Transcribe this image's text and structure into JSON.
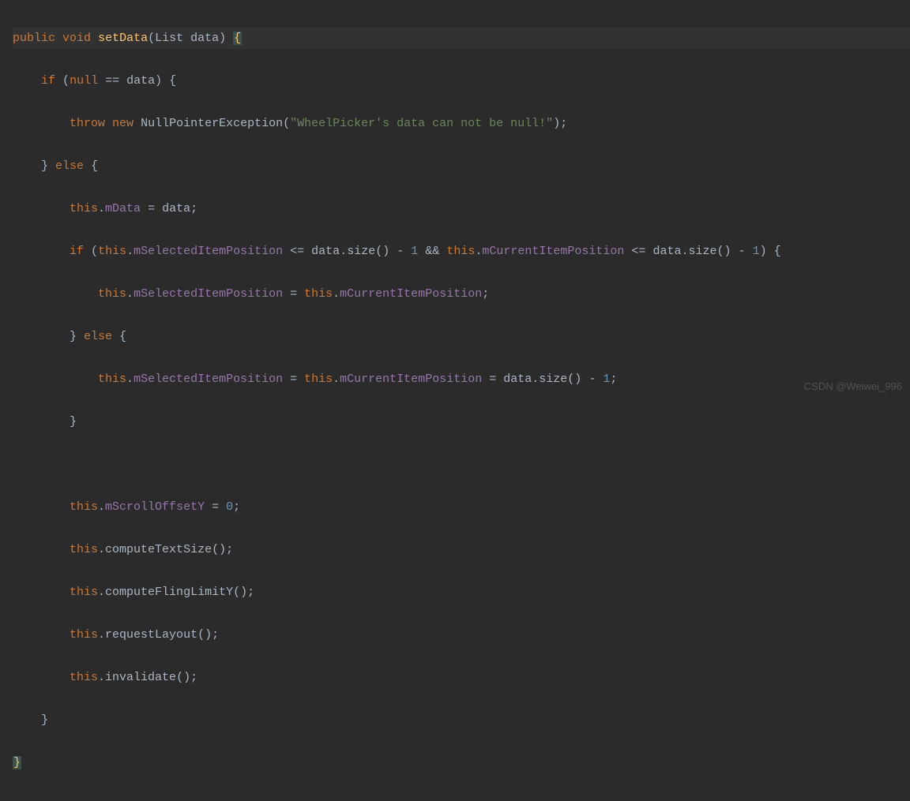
{
  "code": {
    "tokens": {
      "kw_public": "public",
      "kw_void": "void",
      "method_setData": "setData",
      "type_List": "List",
      "param_data": "data",
      "kw_if": "if",
      "kw_null": "null",
      "op_eq": "==",
      "kw_throw": "throw",
      "kw_new": "new",
      "type_NPE": "NullPointerException",
      "str_msg": "\"WheelPicker's data can not be null!\"",
      "kw_else": "else",
      "kw_this": "this",
      "field_mData": "mData",
      "field_mSelectedItemPosition": "mSelectedItemPosition",
      "field_mCurrentItemPosition": "mCurrentItemPosition",
      "field_mScrollOffsetY": "mScrollOffsetY",
      "call_size": "size",
      "call_computeTextSize": "computeTextSize",
      "call_computeFlingLimitY": "computeFlingLimitY",
      "call_requestLayout": "requestLayout",
      "call_invalidate": "invalidate",
      "op_lte": "<=",
      "op_and": "&&",
      "op_minus": "-",
      "op_assign": "=",
      "num_0": "0",
      "num_1": "1"
    }
  },
  "watermark": "CSDN @Weiwei_996"
}
